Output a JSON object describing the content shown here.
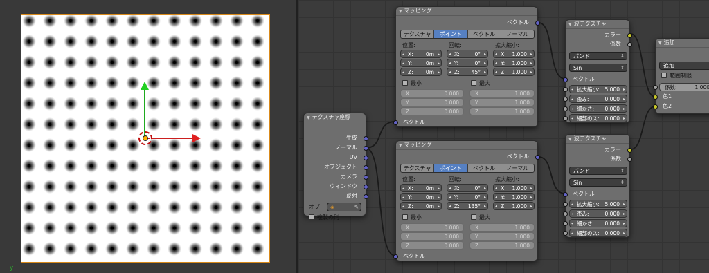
{
  "viewport": {
    "corner_label": "y"
  },
  "texcoord": {
    "title": "テクスチャ座標",
    "outputs": [
      "生成",
      "ノーマル",
      "UV",
      "オブジェクト",
      "カメラ",
      "ウィンドウ",
      "反射"
    ],
    "object_label": "オブ",
    "dupli_label": "複製の則"
  },
  "mapping1": {
    "title": "マッピング",
    "out_label": "ベクトル",
    "tabs": [
      "テクスチャ",
      "ポイント",
      "ベクトル",
      "ノーマル"
    ],
    "active_tab": "ポイント",
    "headers": [
      "位置:",
      "回転:",
      "拡大縮小:"
    ],
    "loc": [
      {
        "l": "X:",
        "v": "0m"
      },
      {
        "l": "Y:",
        "v": "0m"
      },
      {
        "l": "Z:",
        "v": "0m"
      }
    ],
    "rot": [
      {
        "l": "X:",
        "v": "0°"
      },
      {
        "l": "Y:",
        "v": "0°"
      },
      {
        "l": "Z:",
        "v": "45°"
      }
    ],
    "scale": [
      {
        "l": "X:",
        "v": "1.000"
      },
      {
        "l": "Y:",
        "v": "1.000"
      },
      {
        "l": "Z:",
        "v": "1.000"
      }
    ],
    "min_label": "最小",
    "max_label": "最大",
    "min": [
      {
        "l": "X:",
        "v": "0.000"
      },
      {
        "l": "Y:",
        "v": "0.000"
      },
      {
        "l": "Z:",
        "v": "0.000"
      }
    ],
    "max": [
      {
        "l": "X:",
        "v": "1.000"
      },
      {
        "l": "Y:",
        "v": "1.000"
      },
      {
        "l": "Z:",
        "v": "1.000"
      }
    ],
    "in_label": "ベクトル"
  },
  "mapping2": {
    "title": "マッピング",
    "out_label": "ベクトル",
    "tabs": [
      "テクスチャ",
      "ポイント",
      "ベクトル",
      "ノーマル"
    ],
    "active_tab": "ポイント",
    "headers": [
      "位置:",
      "回転:",
      "拡大縮小:"
    ],
    "loc": [
      {
        "l": "X:",
        "v": "0m"
      },
      {
        "l": "Y:",
        "v": "0m"
      },
      {
        "l": "Z:",
        "v": "0m"
      }
    ],
    "rot": [
      {
        "l": "X:",
        "v": "0°"
      },
      {
        "l": "Y:",
        "v": "0°"
      },
      {
        "l": "Z:",
        "v": "135°"
      }
    ],
    "scale": [
      {
        "l": "X:",
        "v": "1.000"
      },
      {
        "l": "Y:",
        "v": "1.000"
      },
      {
        "l": "Z:",
        "v": "1.000"
      }
    ],
    "min_label": "最小",
    "max_label": "最大",
    "min": [
      {
        "l": "X:",
        "v": "0.000"
      },
      {
        "l": "Y:",
        "v": "0.000"
      },
      {
        "l": "Z:",
        "v": "0.000"
      }
    ],
    "max": [
      {
        "l": "X:",
        "v": "1.000"
      },
      {
        "l": "Y:",
        "v": "1.000"
      },
      {
        "l": "Z:",
        "v": "1.000"
      }
    ],
    "in_label": "ベクトル"
  },
  "wave1": {
    "title": "波テクスチャ",
    "out_color": "カラー",
    "out_fac": "係数",
    "type": "バンド",
    "profile": "Sin",
    "in_vector": "ベクトル",
    "params": [
      {
        "l": "拡大縮小:",
        "v": "5.000"
      },
      {
        "l": "歪み:",
        "v": "0.000"
      },
      {
        "l": "細かさ:",
        "v": "0.000"
      },
      {
        "l": "細部のス:",
        "v": "0.000"
      }
    ]
  },
  "wave2": {
    "title": "波テクスチャ",
    "out_color": "カラー",
    "out_fac": "係数",
    "type": "バンド",
    "profile": "Sin",
    "in_vector": "ベクトル",
    "params": [
      {
        "l": "拡大縮小:",
        "v": "5.000"
      },
      {
        "l": "歪み:",
        "v": "0.000"
      },
      {
        "l": "細かさ:",
        "v": "0.000"
      },
      {
        "l": "細部のス:",
        "v": "0.000"
      }
    ]
  },
  "mix": {
    "title": "追加",
    "blend": "追加",
    "clamp_label": "範囲制限",
    "fac_label": "係数:",
    "fac_value": "1.000",
    "in1": "色1",
    "in2": "色2"
  },
  "colors": {
    "vector_socket": "#6363c7",
    "color_socket": "#c7c729",
    "value_socket": "#a1a1a1",
    "active_tab": "#5680c2",
    "link": "#1a1a1a"
  }
}
